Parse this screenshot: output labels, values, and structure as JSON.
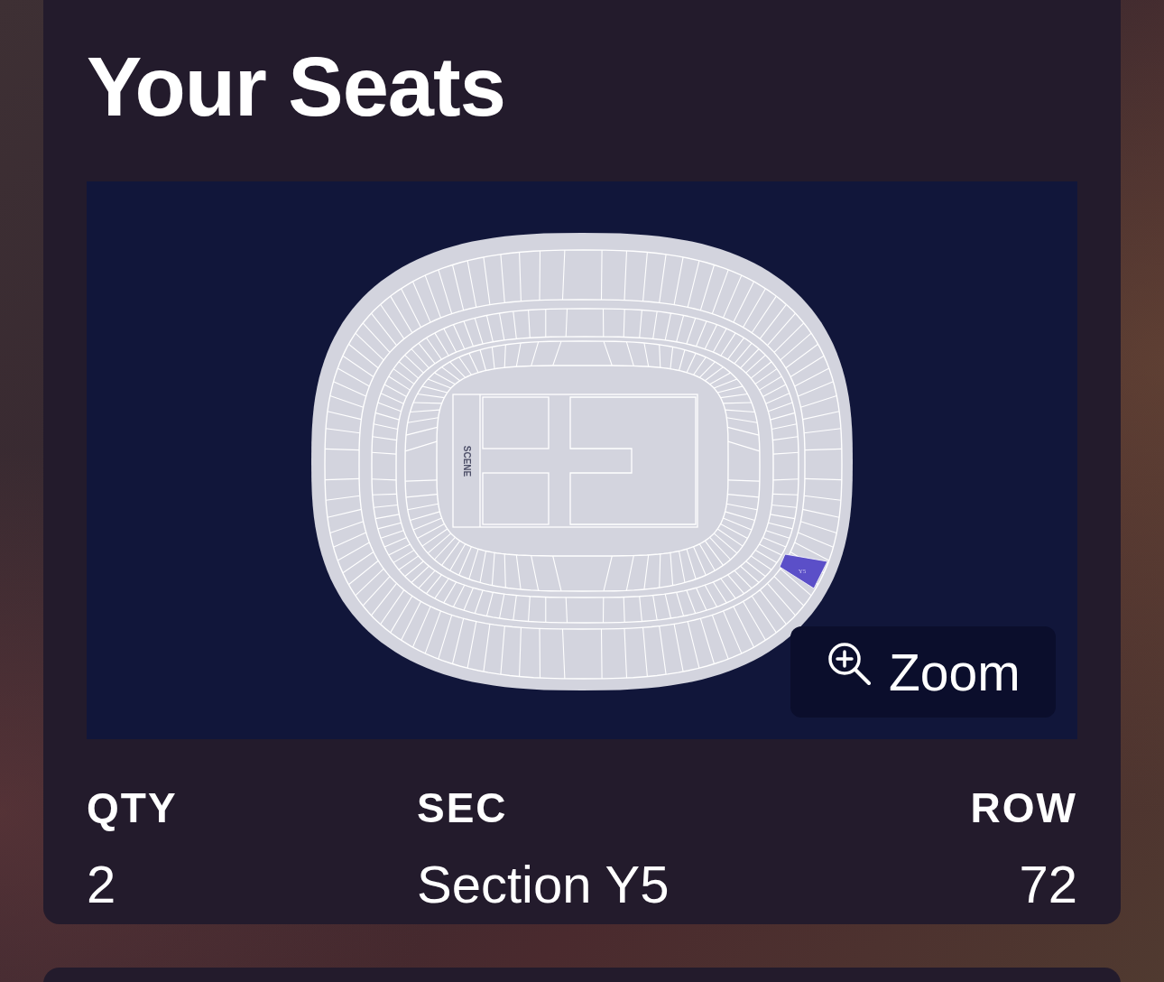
{
  "card": {
    "title": "Your Seats"
  },
  "seat_map": {
    "stage_label": "SCENE",
    "sections": [
      {
        "label": "Y5",
        "selected": true
      }
    ],
    "zoom_button": "Zoom"
  },
  "details": [
    {
      "label": "QTY",
      "value": "2"
    },
    {
      "label": "SEC",
      "value": "Section Y5"
    },
    {
      "label": "ROW",
      "value": "72"
    }
  ]
}
